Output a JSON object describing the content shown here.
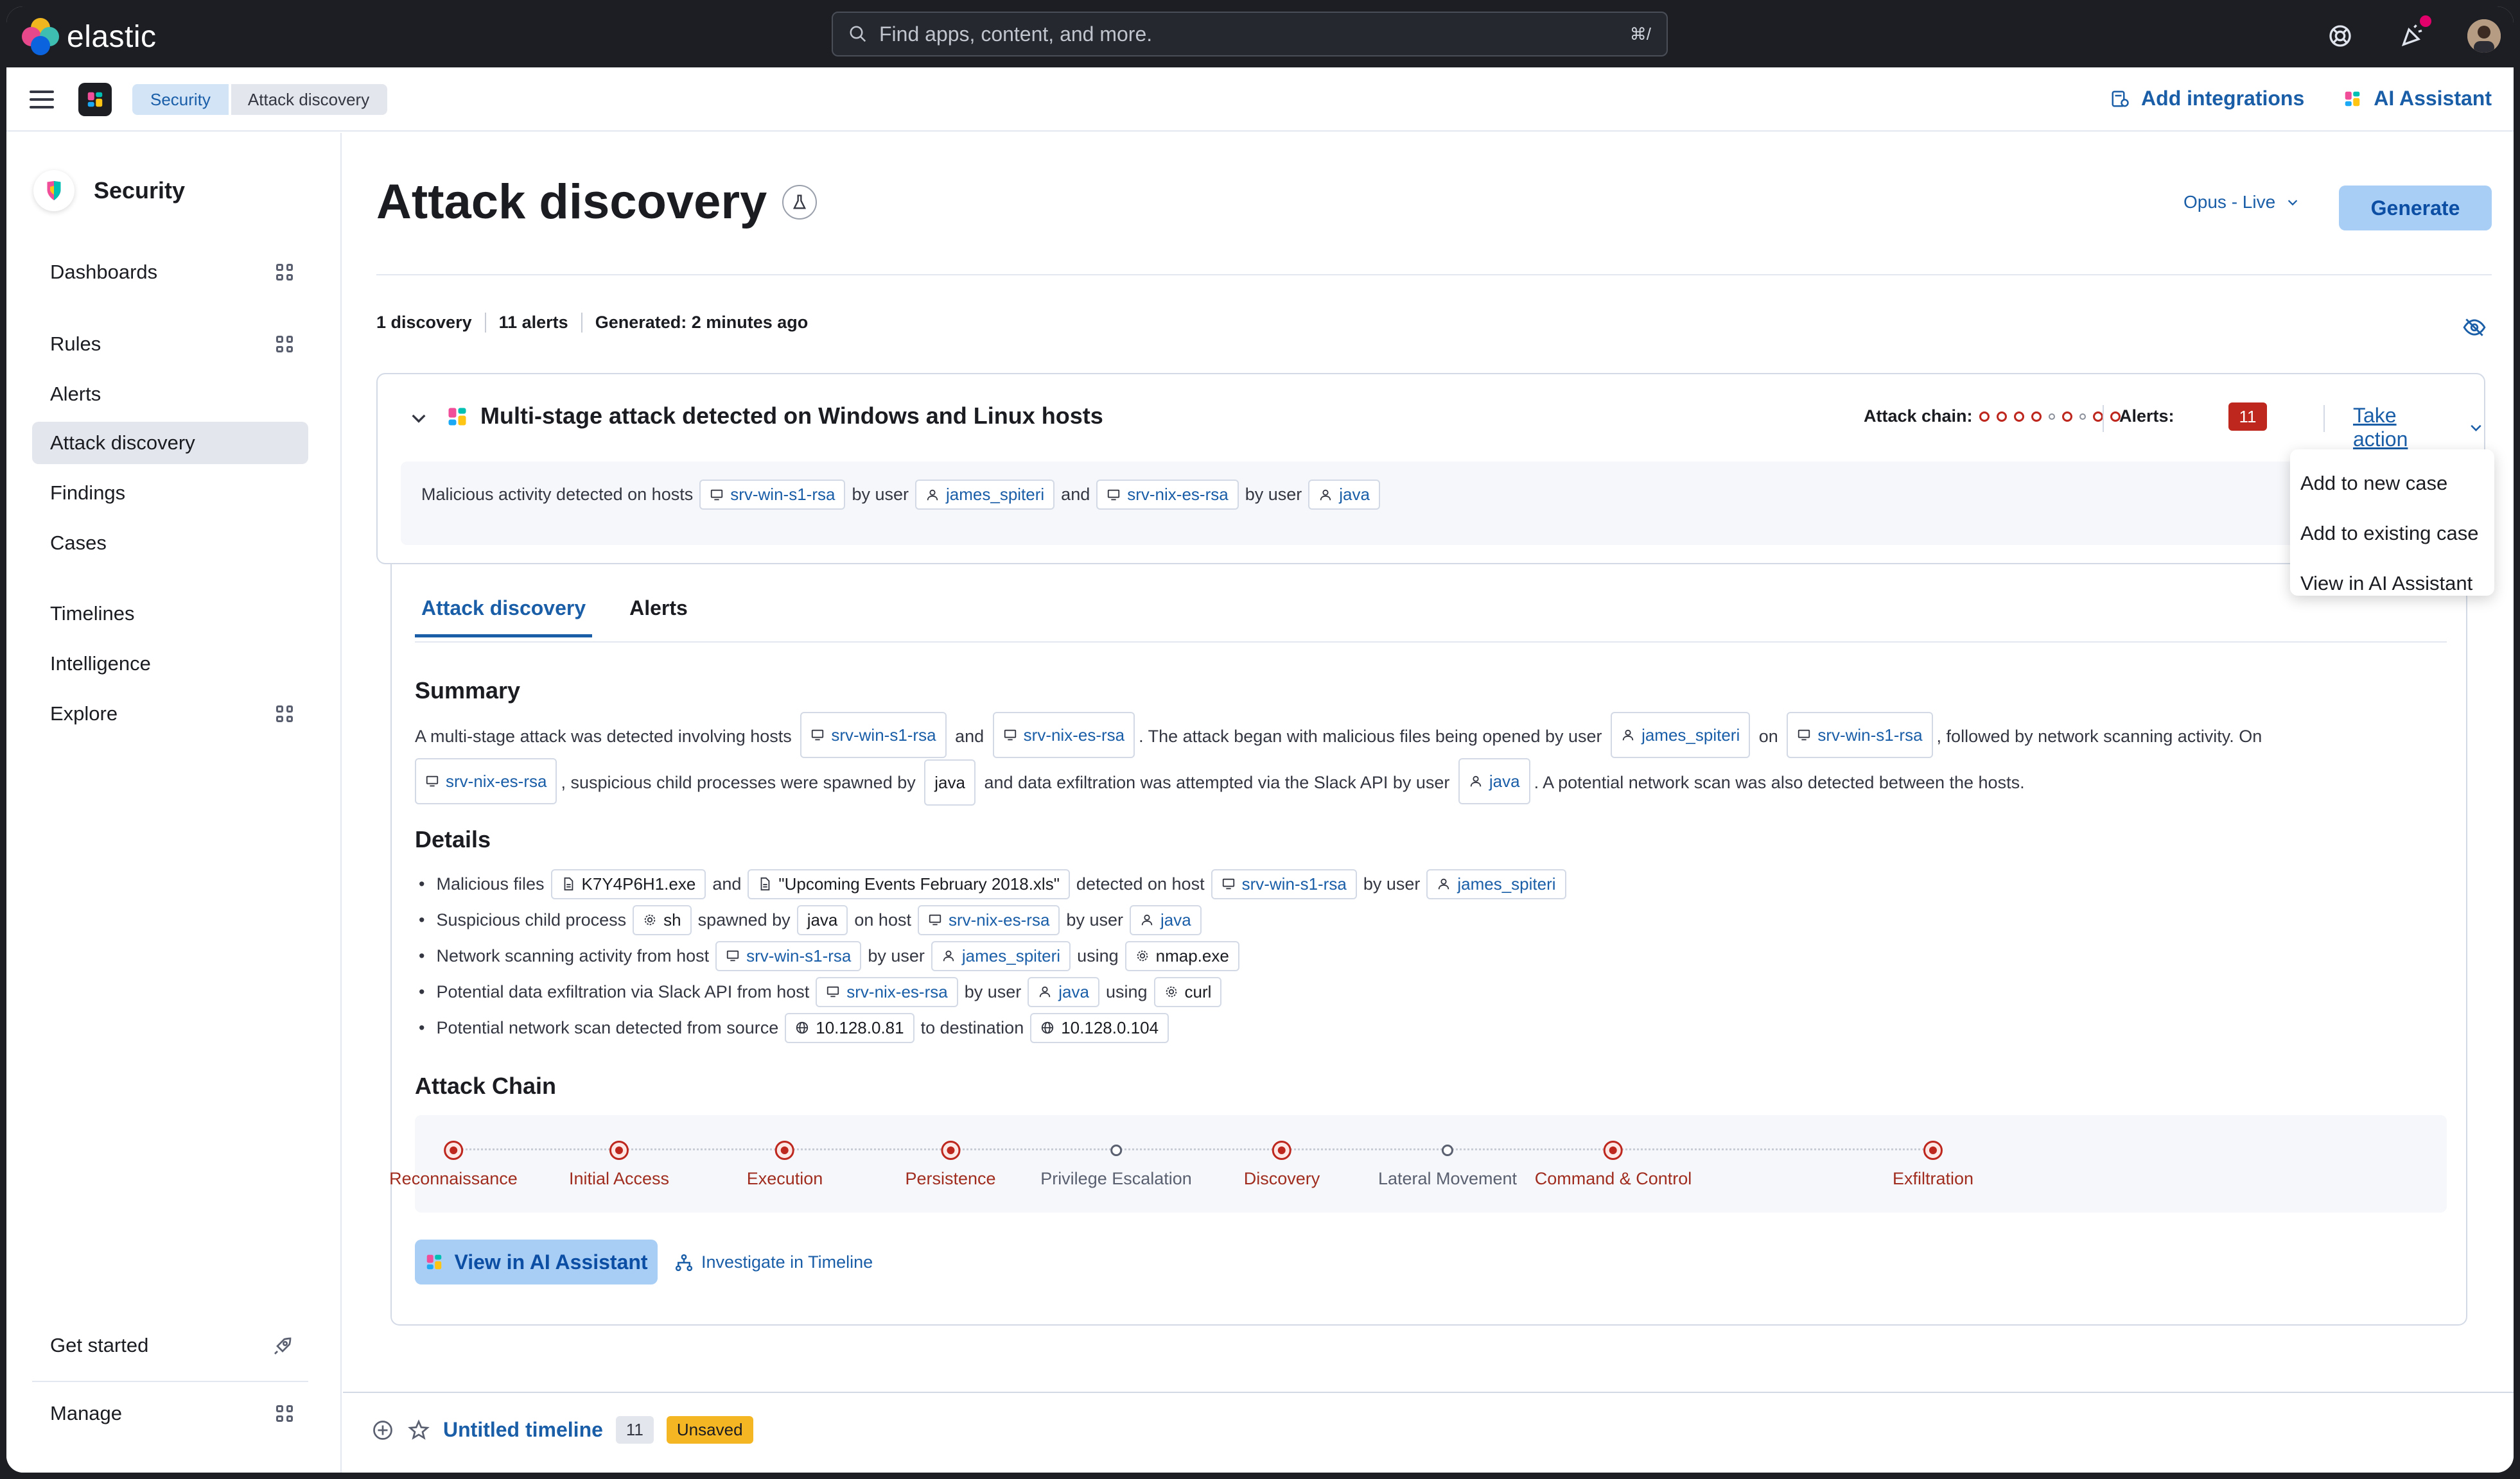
{
  "header": {
    "logo_text": "elastic",
    "search_placeholder": "Find apps, content, and more.",
    "search_shortcut": "⌘/"
  },
  "breadcrumbs": [
    "Security",
    "Attack discovery"
  ],
  "header_actions": {
    "add_integrations": "Add integrations",
    "ai_assistant": "AI Assistant"
  },
  "sidebar": {
    "title": "Security",
    "items": [
      {
        "label": "Dashboards",
        "grid": true
      },
      {
        "label": "Rules",
        "grid": true
      },
      {
        "label": "Alerts",
        "grid": false
      },
      {
        "label": "Attack discovery",
        "grid": false,
        "active": true
      },
      {
        "label": "Findings",
        "grid": false
      },
      {
        "label": "Cases",
        "grid": false
      },
      {
        "label": "Timelines",
        "grid": false
      },
      {
        "label": "Intelligence",
        "grid": false
      },
      {
        "label": "Explore",
        "grid": true
      }
    ],
    "get_started": "Get started",
    "manage": "Manage"
  },
  "page": {
    "title": "Attack discovery",
    "model": "Opus - Live",
    "generate": "Generate",
    "stats": [
      "1 discovery",
      "11 alerts",
      "Generated: 2 minutes ago"
    ]
  },
  "discovery": {
    "title": "Multi-stage attack detected on Windows and Linux hosts",
    "attack_chain_label": "Attack chain:",
    "alerts_label": "Alerts:",
    "alerts_count": "11",
    "take_action": "Take action",
    "summary_text": {
      "t1": "Malicious activity detected on hosts",
      "host1": "srv-win-s1-rsa",
      "by_user": "by user",
      "user1": "james_spiteri",
      "and": "and",
      "host2": "srv-nix-es-rsa",
      "user2": "java"
    },
    "expand_label": "V"
  },
  "dropdown": {
    "items": [
      "Add to new case",
      "Add to existing case",
      "View in AI Assistant"
    ]
  },
  "tabs": [
    "Attack discovery",
    "Alerts"
  ],
  "summary": {
    "heading": "Summary",
    "s1": "A multi-stage attack was detected involving hosts",
    "h1": "srv-win-s1-rsa",
    "and": "and",
    "h2": "srv-nix-es-rsa",
    "s2": ". The attack began with malicious files being opened by user",
    "u1": "james_spiteri",
    "on": "on",
    "h3": "srv-win-s1-rsa",
    "s3": ", followed by network scanning activity. On",
    "h4": "srv-nix-es-rsa",
    "s4": ", suspicious child processes were spawned by",
    "p1": "java",
    "s5": "and data exfiltration was attempted via the Slack API by user",
    "u2": "java",
    "s6": ". A potential network scan was also detected between the hosts."
  },
  "details": {
    "heading": "Details",
    "l1": {
      "t1": "Malicious files",
      "f1": "K7Y4P6H1.exe",
      "t2": "and",
      "f2": "\"Upcoming Events February 2018.xls\"",
      "t3": "detected on host",
      "h": "srv-win-s1-rsa",
      "t4": "by user",
      "u": "james_spiteri"
    },
    "l2": {
      "t1": "Suspicious child process",
      "p": "sh",
      "t2": "spawned by",
      "p2": "java",
      "t3": "on host",
      "h": "srv-nix-es-rsa",
      "t4": "by user",
      "u": "java"
    },
    "l3": {
      "t1": "Network scanning activity from host",
      "h": "srv-win-s1-rsa",
      "t2": "by user",
      "u": "james_spiteri",
      "t3": "using",
      "p": "nmap.exe"
    },
    "l4": {
      "t1": "Potential data exfiltration via Slack API from host",
      "h": "srv-nix-es-rsa",
      "t2": "by user",
      "u": "java",
      "t3": "using",
      "p": "curl"
    },
    "l5": {
      "t1": "Potential network scan detected from source",
      "ip1": "10.128.0.81",
      "t2": "to destination",
      "ip2": "10.128.0.104"
    }
  },
  "attack_chain": {
    "heading": "Attack Chain",
    "tactics": [
      {
        "label": "Reconnaissance",
        "detected": true
      },
      {
        "label": "Initial Access",
        "detected": true
      },
      {
        "label": "Execution",
        "detected": true
      },
      {
        "label": "Persistence",
        "detected": true
      },
      {
        "label": "Privilege Escalation",
        "detected": false
      },
      {
        "label": "Discovery",
        "detected": true
      },
      {
        "label": "Lateral Movement",
        "detected": false
      },
      {
        "label": "Command & Control",
        "detected": true
      },
      {
        "label": "Exfiltration",
        "detected": true
      }
    ]
  },
  "actions": {
    "view_ai": "View in AI Assistant",
    "investigate": "Investigate in Timeline"
  },
  "timeline_bar": {
    "title": "Untitled timeline",
    "count": "11",
    "status": "Unsaved"
  },
  "colors": {
    "accent": "#1a5ea8",
    "danger": "#bd271e",
    "header_bg": "#1d1e24",
    "button_bg": "#a8cef5"
  }
}
